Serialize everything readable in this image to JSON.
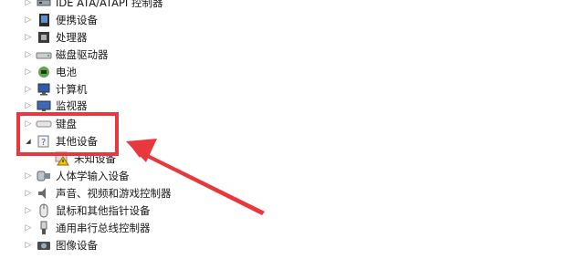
{
  "device_tree": {
    "items": [
      {
        "name": "IDE ATA/ATAPI 控制器",
        "expander": "▷",
        "icon": "ide-controller-icon"
      },
      {
        "name": "便携设备",
        "expander": "▷",
        "icon": "portable-device-icon"
      },
      {
        "name": "处理器",
        "expander": "▷",
        "icon": "processor-icon"
      },
      {
        "name": "磁盘驱动器",
        "expander": "▷",
        "icon": "disk-drive-icon"
      },
      {
        "name": "电池",
        "expander": "▷",
        "icon": "battery-icon"
      },
      {
        "name": "计算机",
        "expander": "▷",
        "icon": "computer-icon"
      },
      {
        "name": "监视器",
        "expander": "▷",
        "icon": "monitor-icon"
      },
      {
        "name": "键盘",
        "expander": "▷",
        "icon": "keyboard-icon"
      },
      {
        "name": "其他设备",
        "expander": "◢",
        "icon": "other-devices-icon"
      },
      {
        "name": "未知设备",
        "expander": "",
        "icon": "unknown-device-warning-icon"
      },
      {
        "name": "人体学输入设备",
        "expander": "▷",
        "icon": "hid-icon"
      },
      {
        "name": "声音、视频和游戏控制器",
        "expander": "▷",
        "icon": "speaker-icon"
      },
      {
        "name": "鼠标和其他指针设备",
        "expander": "▷",
        "icon": "mouse-icon"
      },
      {
        "name": "通用串行总线控制器",
        "expander": "▷",
        "icon": "usb-icon"
      },
      {
        "name": "图像设备",
        "expander": "▷",
        "icon": "camera-icon"
      }
    ]
  },
  "annotation": {
    "box_color": "#e9383d",
    "arrow_color": "#e9383d"
  }
}
